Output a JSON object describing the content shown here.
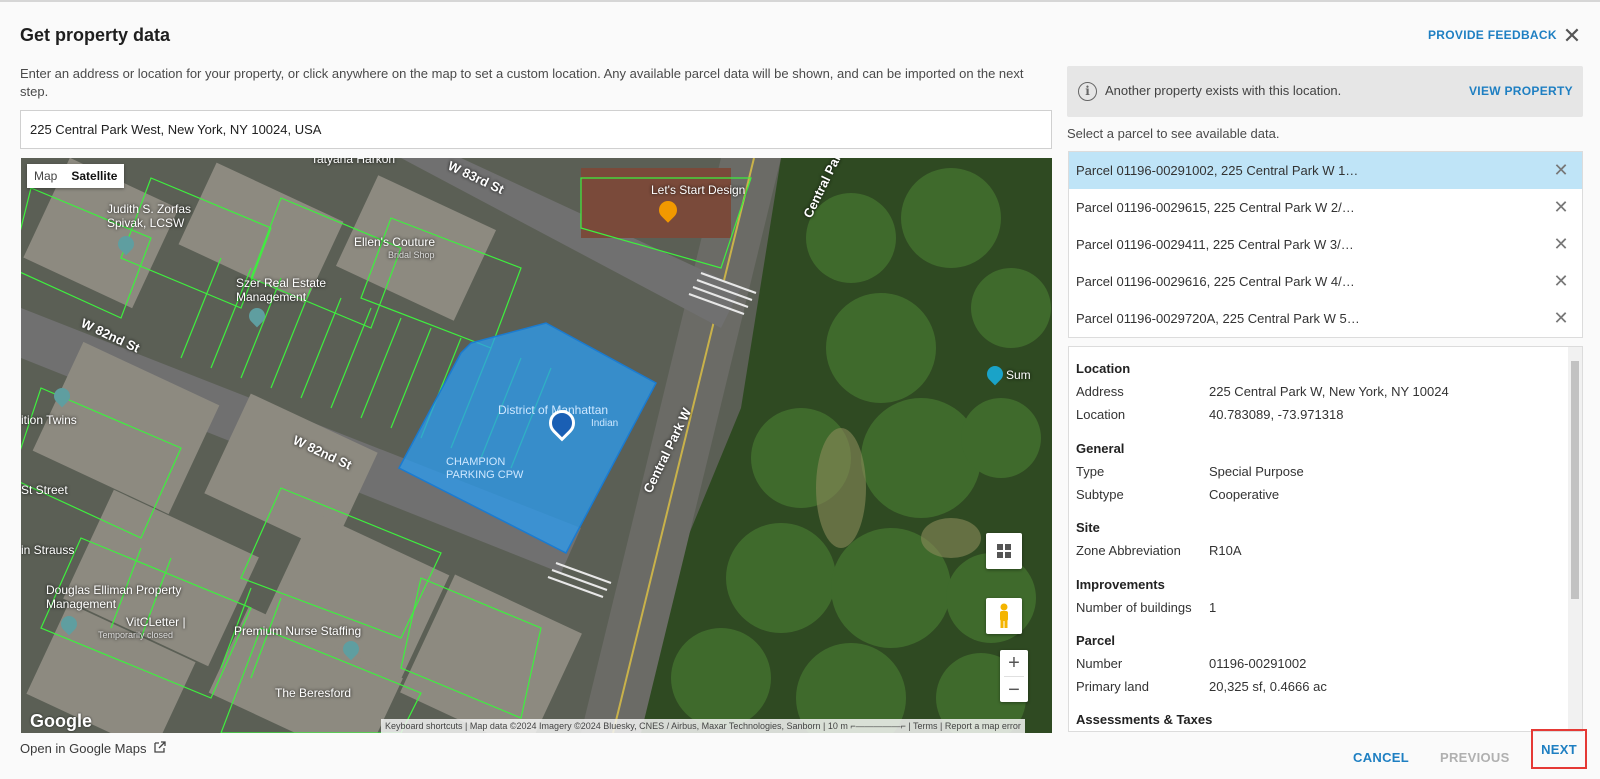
{
  "dialog": {
    "title": "Get property data",
    "feedback_label": "PROVIDE FEEDBACK",
    "close_glyph": "✕",
    "intro": "Enter an address or location for your property, or click anywhere on the map to set a custom location. Any available parcel data will be shown, and can be imported on the next step.",
    "address_value": "225 Central Park West, New York, NY 10024, USA"
  },
  "map": {
    "type_map": "Map",
    "type_satellite": "Satellite",
    "selected_type": "Satellite",
    "zoom_in": "+",
    "zoom_out": "−",
    "logo": "Google",
    "attribution": "Keyboard shortcuts  |  Map data ©2024 Imagery ©2024 Bluesky, CNES / Airbus, Maxar Technologies, Sanborn  |  10 m ⌐—————⌐  |  Terms  |  Report a map error",
    "labels": {
      "west_83rd": "W 83rd St",
      "west_82nd_a": "W 82nd St",
      "west_82nd_b": "W 82nd St",
      "central_park_w_a": "Central Park W",
      "central_park_w_b": "Central Park W",
      "tatyana": "Tatyana Harkon",
      "judith": "Judith S. Zorfas Spivak, LCSW",
      "ellens": "Ellen's Couture",
      "ellens_sub": "Bridal Shop",
      "lets_start": "Let's Start Design",
      "szer": "Szer Real Estate Management",
      "district": "District of Manhattan",
      "indian": "Indian",
      "champion": "CHAMPION PARKING CPW",
      "twins": "ition Twins",
      "st_street": "St Street",
      "strauss": "in Strauss",
      "douglas": "Douglas Elliman Property Management",
      "vitc": "VitCLetter |",
      "vitc_sub": "Temporarily closed",
      "premium": "Premium Nurse Staffing",
      "beresford": "The Beresford",
      "sum": "Sum"
    },
    "open_link": "Open in Google Maps"
  },
  "panel": {
    "banner_message": "Another property exists with this location.",
    "view_property": "VIEW PROPERTY",
    "select_hint": "Select a parcel to see available data.",
    "parcels": [
      "Parcel 01196-00291002, 225 Central Park W 1…",
      "Parcel 01196-0029615, 225 Central Park W 2/…",
      "Parcel 01196-0029411, 225 Central Park W 3/…",
      "Parcel 01196-0029616, 225 Central Park W 4/…",
      "Parcel 01196-0029720A, 225 Central Park W 5…"
    ],
    "details": {
      "location_h": "Location",
      "address_l": "Address",
      "address_v": "225 Central Park W, New York, NY 10024",
      "location_l": "Location",
      "location_v": "40.783089, -73.971318",
      "general_h": "General",
      "type_l": "Type",
      "type_v": "Special Purpose",
      "subtype_l": "Subtype",
      "subtype_v": "Cooperative",
      "site_h": "Site",
      "zone_l": "Zone Abbreviation",
      "zone_v": "R10A",
      "improvements_h": "Improvements",
      "buildings_l": "Number of buildings",
      "buildings_v": "1",
      "parcel_h": "Parcel",
      "number_l": "Number",
      "number_v": "01196-00291002",
      "primary_l": "Primary land",
      "primary_v": "20,325 sf, 0.4666 ac",
      "assess_h": "Assessments & Taxes"
    }
  },
  "footer": {
    "cancel": "CANCEL",
    "previous": "PREVIOUS",
    "next": "NEXT"
  },
  "colors": {
    "accent": "#1e7fc2",
    "selected_row": "#bfe4f7",
    "parcel_highlight": "#2b9cf2",
    "parcel_lines": "#3ef03e",
    "next_outline": "#e53935"
  }
}
